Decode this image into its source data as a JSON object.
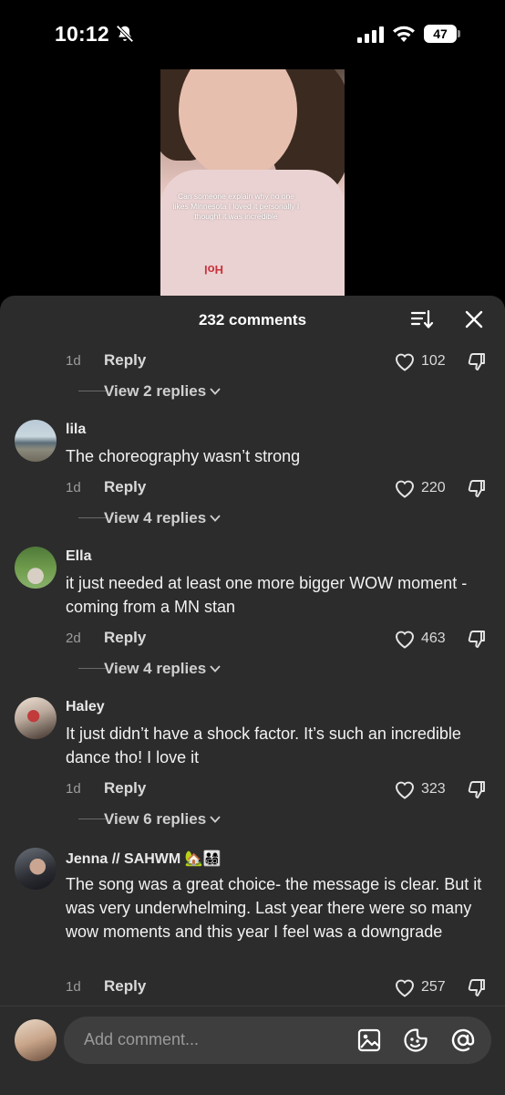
{
  "status": {
    "time": "10:12",
    "battery": "47"
  },
  "video": {
    "caption": "Can someone explain why no one likes Minnesota I loved it personally I thought it was incredible",
    "shirt_text": "Hol"
  },
  "header": {
    "title": "232 comments"
  },
  "comments": [
    {
      "username": "",
      "text": "",
      "age": "1d",
      "reply": "Reply",
      "likes": "102",
      "view_replies": "View 2 replies"
    },
    {
      "username": "lila",
      "text": "The choreography wasn’t strong",
      "age": "1d",
      "reply": "Reply",
      "likes": "220",
      "view_replies": "View 4 replies"
    },
    {
      "username": "Ella",
      "text": "it just needed at least one more bigger WOW moment -coming from a MN stan",
      "age": "2d",
      "reply": "Reply",
      "likes": "463",
      "view_replies": "View 4 replies"
    },
    {
      "username": "Haley",
      "text": "It just didn’t have a shock factor. It’s such an incredible dance tho! I love it",
      "age": "1d",
      "reply": "Reply",
      "likes": "323",
      "view_replies": "View 6 replies"
    },
    {
      "username": "Jenna // SAHWM 🏡👨‍👩‍👧‍👦",
      "text": "The song was a great choice- the message is clear. But it was very underwhelming. Last year there were so many wow moments and this year I feel was a downgrade",
      "age": "1d",
      "reply": "Reply",
      "likes": "257",
      "view_replies": ""
    }
  ],
  "input": {
    "placeholder": "Add comment..."
  }
}
